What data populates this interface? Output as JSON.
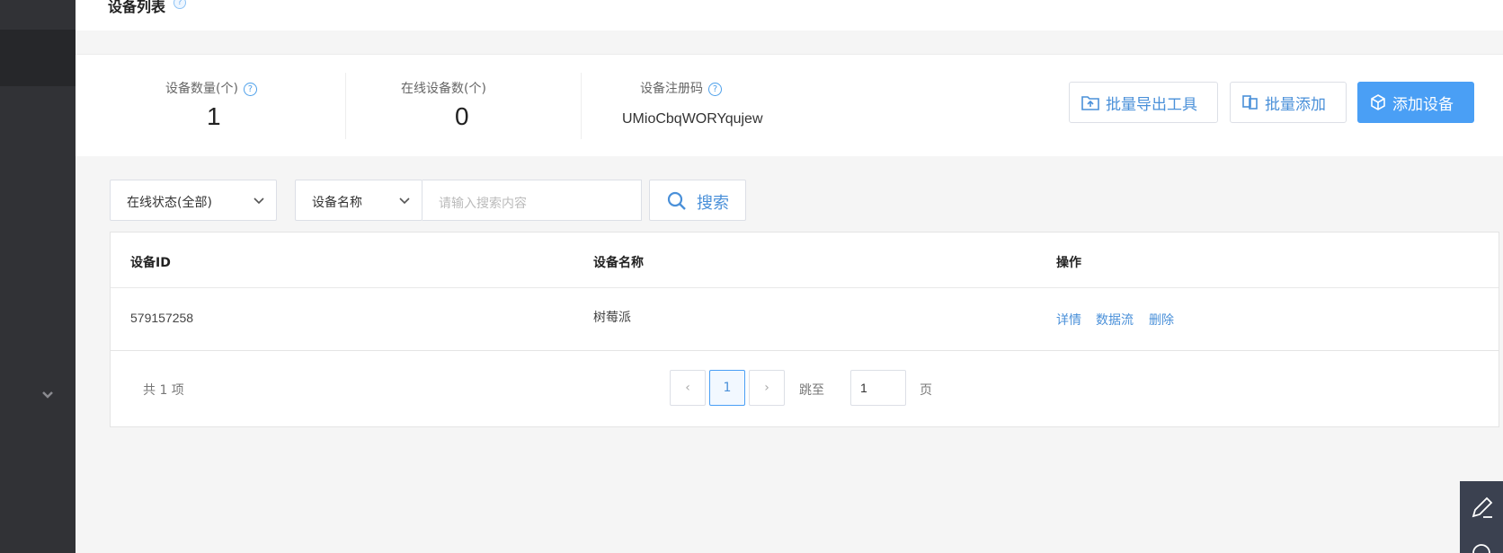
{
  "page": {
    "title": "设备列表",
    "title_help": "?"
  },
  "stats": {
    "device_count_label": "设备数量(个)",
    "device_count_value": "1",
    "online_count_label": "在线设备数(个)",
    "online_count_value": "0",
    "register_code_label": "设备注册码",
    "register_code_value": "UMioCbqWORYqujew",
    "help_mark": "?"
  },
  "actions": {
    "batch_export_label": "批量导出工具",
    "batch_add_label": "批量添加",
    "add_device_label": "添加设备"
  },
  "filters": {
    "status_select_value": "在线状态(全部)",
    "field_select_value": "设备名称",
    "search_placeholder": "请输入搜索内容",
    "search_button_label": "搜索"
  },
  "table": {
    "columns": [
      "设备ID",
      "设备名称",
      "操作"
    ],
    "rows": [
      {
        "id": "579157258",
        "name": "树莓派",
        "actions": [
          "详情",
          "数据流",
          "删除"
        ]
      }
    ]
  },
  "pagination": {
    "total_text": "共 1 项",
    "prev_symbol": "‹",
    "current_page": "1",
    "next_symbol": "›",
    "jump_label": "跳至",
    "jump_value": "1",
    "page_unit": "页"
  },
  "colors": {
    "accent": "#4a9ff5",
    "link": "#4a90d9",
    "sidebar": "#313236"
  }
}
